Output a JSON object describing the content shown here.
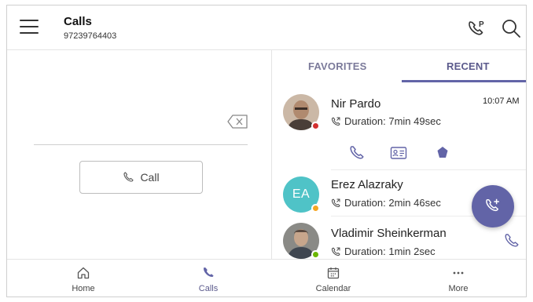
{
  "header": {
    "title": "Calls",
    "subtitle": "97239764403",
    "menu_icon": "hamburger-icon",
    "park_icon": "call-park-icon",
    "search_icon": "search-icon"
  },
  "dialpad": {
    "call_label": "Call",
    "backspace_icon": "backspace-icon"
  },
  "tabs": [
    {
      "label": "FAVORITES",
      "active": false
    },
    {
      "label": "RECENT",
      "active": true
    }
  ],
  "recent": [
    {
      "name": "Nir Pardo",
      "duration": "Duration: 7min 49sec",
      "time": "10:07 AM",
      "presence": "busy",
      "avatar": "photo"
    },
    {
      "name": "Erez Alazraky",
      "duration": "Duration: 2min 46sec",
      "presence": "away",
      "avatar": "initials",
      "initials": "EA"
    },
    {
      "name": "Vladimir Sheinkerman",
      "duration": "Duration: 1min 2sec",
      "presence": "available",
      "avatar": "photo"
    }
  ],
  "nav": [
    {
      "label": "Home",
      "icon": "home-icon",
      "active": false
    },
    {
      "label": "Calls",
      "icon": "phone-icon",
      "active": true
    },
    {
      "label": "Calendar",
      "icon": "calendar-icon",
      "active": false
    },
    {
      "label": "More",
      "icon": "more-icon",
      "active": false
    }
  ],
  "colors": {
    "accent": "#6264a7",
    "initials_avatar": "#4fc3c7",
    "presence_busy": "#d32f2f",
    "presence_away": "#f5a623",
    "presence_available": "#6bb700"
  }
}
